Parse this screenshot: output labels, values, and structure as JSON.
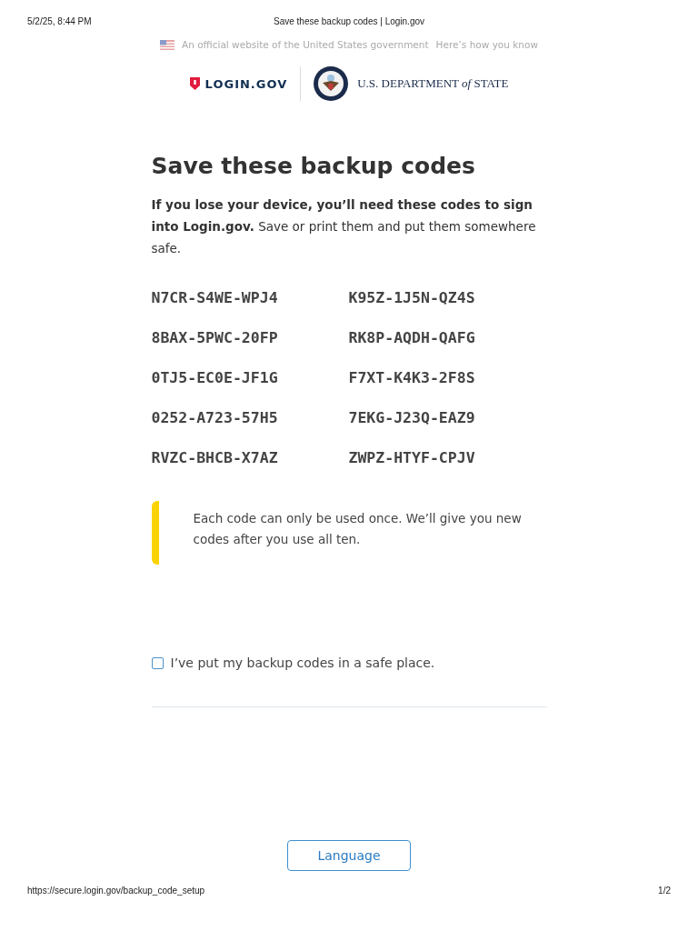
{
  "print_header": {
    "date": "5/2/25, 8:44 PM",
    "title": "Save these backup codes | Login.gov"
  },
  "gov_banner": {
    "text": "An official website of the United States government",
    "link": "Here’s how you know"
  },
  "logos": {
    "login": "LOGIN.GOV",
    "state": "U.S. DEPARTMENT *of* STATE"
  },
  "heading": "Save these backup codes",
  "intro": "**If you lose your device, you’ll need these codes to sign into Login.gov.** Save or print them and put them somewhere safe.",
  "codes": [
    "N7CR-S4WE-WPJ4",
    "K95Z-1J5N-QZ4S",
    "8BAX-5PWC-20FP",
    "RK8P-AQDH-QAFG",
    "0TJ5-EC0E-JF1G",
    "F7XT-K4K3-2F8S",
    "0252-A723-57H5",
    "7EKG-J23Q-EAZ9",
    "RVZC-BHCB-X7AZ",
    "ZWPZ-HTYF-CPJV"
  ],
  "alert": "Each code can only be used once. We’ll give you new codes after you use all ten.",
  "confirm": {
    "label": "I’ve put my backup codes in a safe place.",
    "checked": false
  },
  "language_button": "Language",
  "print_footer": {
    "url": "https://secure.login.gov/backup_code_setup",
    "page": "1/2"
  }
}
